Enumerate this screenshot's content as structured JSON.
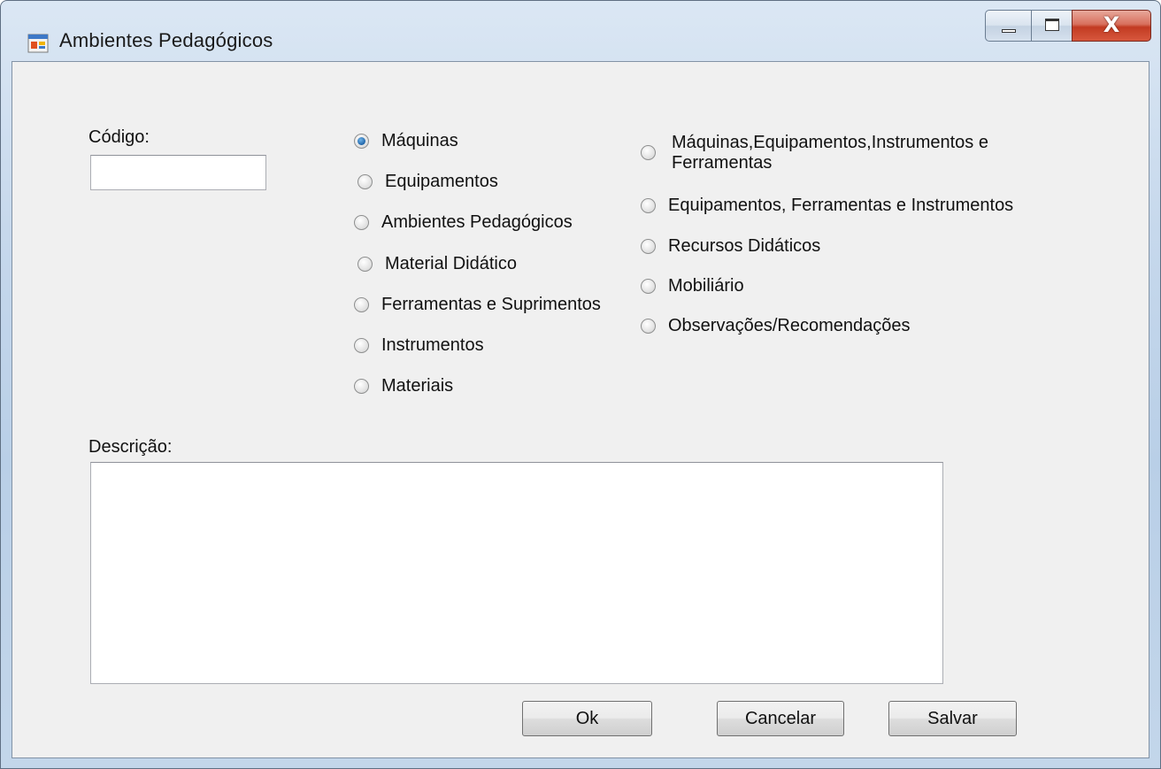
{
  "window": {
    "title": "Ambientes Pedagógicos",
    "icon": "form-app-icon",
    "caption_buttons": {
      "minimize_icon": "minimize-icon",
      "maximize_icon": "maximize-icon",
      "close_glyph": "X"
    }
  },
  "form": {
    "codigo_label": "Código:",
    "codigo_value": "",
    "descricao_label": "Descrição:",
    "descricao_value": "",
    "radio_left": [
      {
        "label": "Máquinas",
        "checked": true
      },
      {
        "label": "Equipamentos",
        "checked": false
      },
      {
        "label": "Ambientes Pedagógicos",
        "checked": false
      },
      {
        "label": "Material Didático",
        "checked": false
      },
      {
        "label": "Ferramentas e Suprimentos",
        "checked": false
      },
      {
        "label": "Instrumentos",
        "checked": false
      },
      {
        "label": "Materiais",
        "checked": false
      }
    ],
    "radio_right": [
      {
        "label_line1": "Máquinas,Equipamentos,Instrumentos e",
        "label_line2": "Ferramentas",
        "checked": false
      },
      {
        "label": "Equipamentos, Ferramentas e Instrumentos",
        "checked": false
      },
      {
        "label": "Recursos Didáticos",
        "checked": false
      },
      {
        "label": "Mobiliário",
        "checked": false
      },
      {
        "label": "Observações/Recomendações",
        "checked": false
      }
    ],
    "buttons": {
      "ok": "Ok",
      "cancelar": "Cancelar",
      "salvar": "Salvar"
    }
  },
  "colors": {
    "accent_radio": "#1f64a8",
    "close_button": "#c23b22",
    "client_background": "#f0f0f0"
  }
}
